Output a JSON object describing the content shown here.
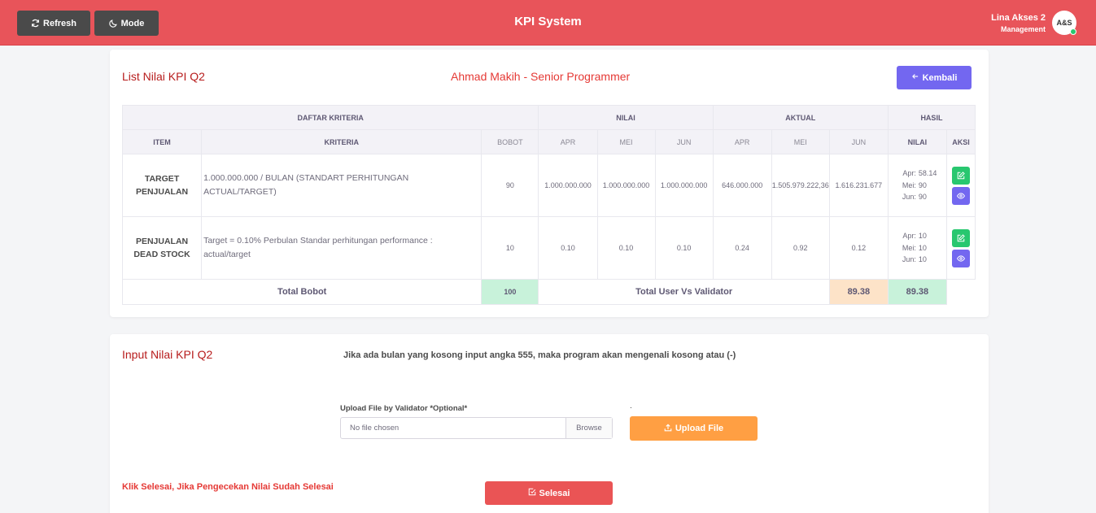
{
  "header": {
    "refresh_label": "Refresh",
    "mode_label": "Mode",
    "title": "KPI System",
    "user_name": "Lina Akses 2",
    "user_role": "Management",
    "avatar_text": "A&S",
    "accent_color": "#e8545a"
  },
  "list_card": {
    "title": "List Nilai KPI Q2",
    "person": "Ahmad Makih - Senior Programmer",
    "back_label": "Kembali"
  },
  "table": {
    "group_headers": {
      "criteria": "DAFTAR KRITERIA",
      "nilai": "NILAI",
      "aktual": "AKTUAL",
      "hasil": "HASIL"
    },
    "sub_headers": {
      "item": "ITEM",
      "kriteria": "KRITERIA",
      "bobot": "BOBOT",
      "nilai_apr": "APR",
      "nilai_mei": "MEI",
      "nilai_jun": "JUN",
      "aktual_apr": "APR",
      "aktual_mei": "MEI",
      "aktual_jun": "JUN",
      "hasil_nilai": "NILAI",
      "aksi": "AKSI"
    },
    "rows": [
      {
        "item": "TARGET PENJUALAN",
        "kriteria": " 1.000.000.000 / BULAN (STANDART PERHITUNGAN ACTUAL/TARGET)",
        "bobot": "90",
        "nilai_apr": "1.000.000.000",
        "nilai_mei": "1.000.000.000",
        "nilai_jun": "1.000.000.000",
        "aktual_apr": "646.000.000",
        "aktual_mei": "1.505.979.222,36",
        "aktual_jun": "1.616.231.677",
        "hasil": [
          {
            "label": "Apr:",
            "value": "58.14"
          },
          {
            "label": "Mei:",
            "value": "90"
          },
          {
            "label": "Jun:",
            "value": "90"
          }
        ]
      },
      {
        "item": "PENJUALAN DEAD STOCK",
        "kriteria": " Target = 0.10% Perbulan Standar perhitungan performance : actual/target",
        "bobot": "10",
        "nilai_apr": "0.10",
        "nilai_mei": "0.10",
        "nilai_jun": "0.10",
        "aktual_apr": "0.24",
        "aktual_mei": "0.92",
        "aktual_jun": "0.12",
        "hasil": [
          {
            "label": "Apr:",
            "value": "10"
          },
          {
            "label": "Mei:",
            "value": "10"
          },
          {
            "label": "Jun:",
            "value": "10"
          }
        ]
      }
    ],
    "totals": {
      "bobot_label": "Total Bobot",
      "bobot_value": "100",
      "compare_label": "Total User Vs Validator",
      "user_value": "89.38",
      "validator_value": "89.38"
    }
  },
  "input_card": {
    "title": "Input Nilai KPI Q2",
    "note": "Jika ada bulan yang kosong input angka 555, maka program akan mengenali kosong atau (-)",
    "upload_label": "Upload File by Validator *Optional*",
    "dot": ".",
    "file_placeholder": "No file chosen",
    "browse_label": "Browse",
    "upload_button": "Upload File",
    "klik_note": "Klik Selesai, Jika Pengecekan Nilai Sudah Selesai",
    "selesai_button": "Selesai"
  }
}
